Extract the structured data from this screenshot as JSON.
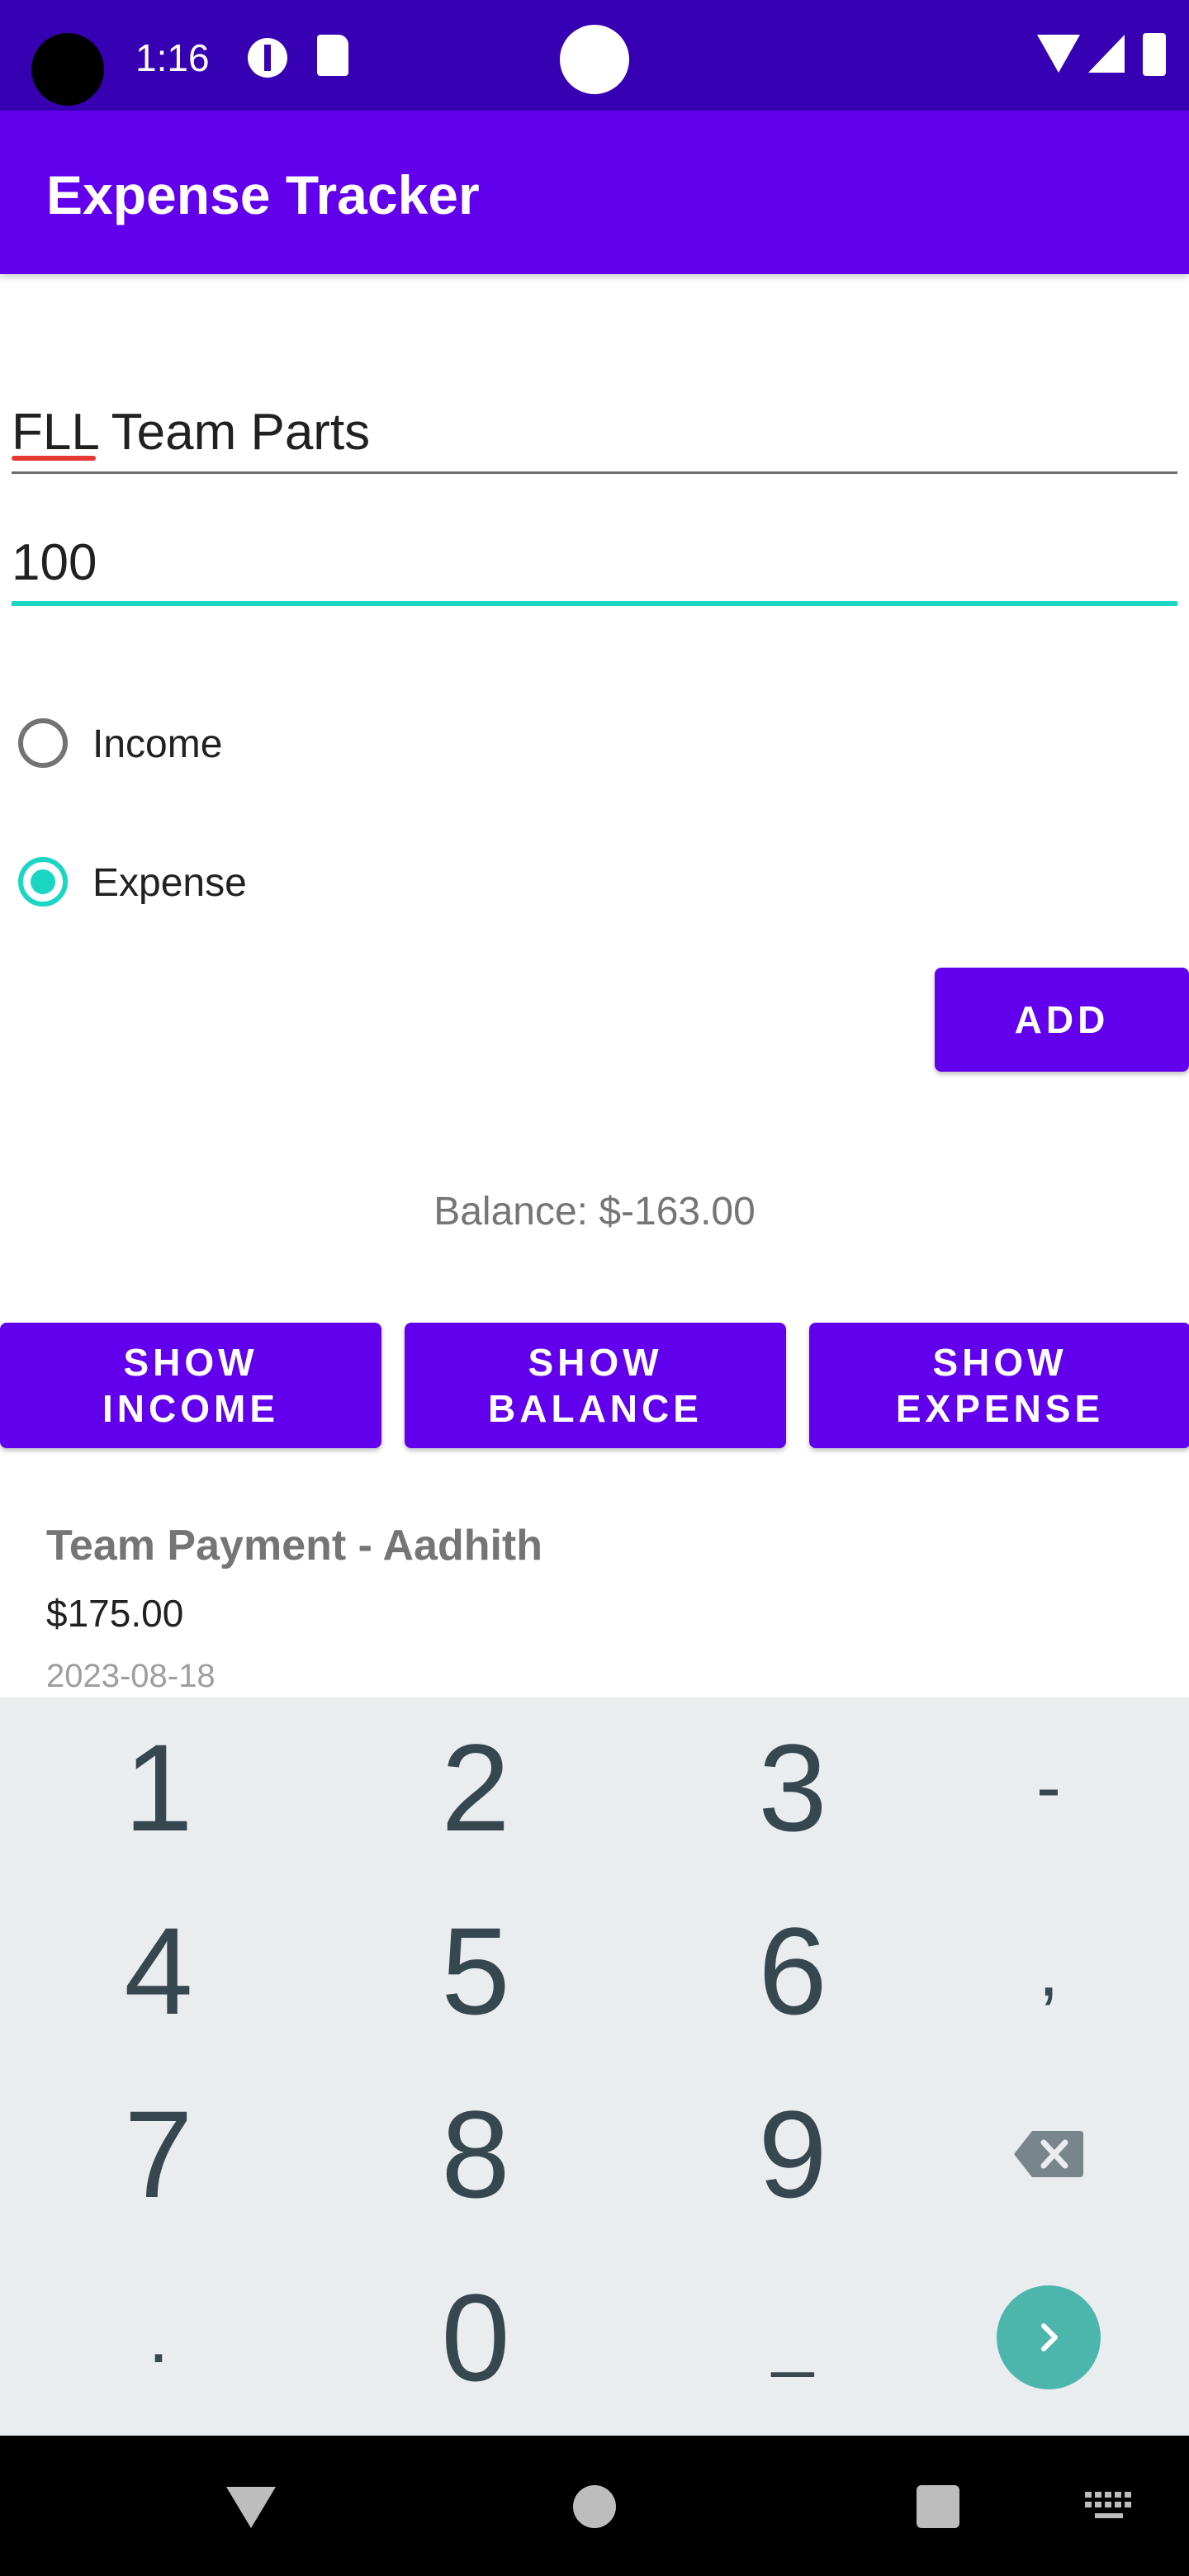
{
  "status_bar": {
    "time": "1:16"
  },
  "app_bar": {
    "title": "Expense Tracker"
  },
  "form": {
    "name_value": "FLL Team Parts",
    "amount_value": "100",
    "radio_options": [
      {
        "label": "Income",
        "selected": false
      },
      {
        "label": "Expense",
        "selected": true
      }
    ],
    "add_label": "ADD"
  },
  "balance": {
    "text": "Balance: $-163.00"
  },
  "filter_buttons": [
    {
      "label": "SHOW\nINCOME"
    },
    {
      "label": "SHOW\nBALANCE"
    },
    {
      "label": "SHOW\nEXPENSE"
    }
  ],
  "transactions": [
    {
      "title": "Team Payment - Aadhith",
      "amount": "$175.00",
      "date": "2023-08-18"
    }
  ],
  "keyboard": {
    "keys": [
      "1",
      "2",
      "3",
      "-",
      "4",
      "5",
      "6",
      ",",
      "7",
      "8",
      "9",
      ".",
      "0",
      "_"
    ]
  },
  "colors": {
    "primary": "#6200ee",
    "primary_dark": "#3700b3",
    "accent": "#1cd6c4",
    "enter_key": "#4db6ac"
  },
  "icons": {
    "backspace": "backspace-icon",
    "enter": "chevron-right-icon",
    "nav_back": "back-triangle-icon",
    "nav_home": "home-circle-icon",
    "nav_recents": "recents-square-icon",
    "nav_keyboard": "keyboard-icon"
  }
}
